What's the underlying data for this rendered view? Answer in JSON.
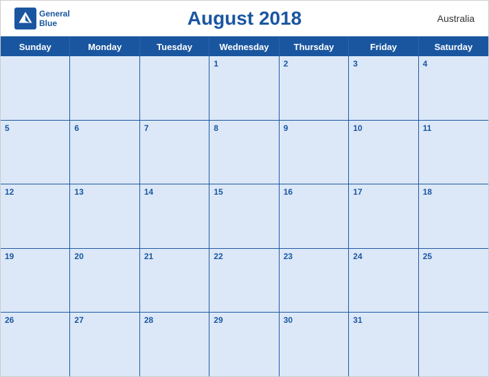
{
  "header": {
    "title": "August 2018",
    "country": "Australia",
    "logo": {
      "line1": "General",
      "line2": "Blue"
    }
  },
  "days_of_week": [
    "Sunday",
    "Monday",
    "Tuesday",
    "Wednesday",
    "Thursday",
    "Friday",
    "Saturday"
  ],
  "weeks": [
    [
      {
        "date": null
      },
      {
        "date": null
      },
      {
        "date": null
      },
      {
        "date": "1"
      },
      {
        "date": "2"
      },
      {
        "date": "3"
      },
      {
        "date": "4"
      }
    ],
    [
      {
        "date": "5"
      },
      {
        "date": "6"
      },
      {
        "date": "7"
      },
      {
        "date": "8"
      },
      {
        "date": "9"
      },
      {
        "date": "10"
      },
      {
        "date": "11"
      }
    ],
    [
      {
        "date": "12"
      },
      {
        "date": "13"
      },
      {
        "date": "14"
      },
      {
        "date": "15"
      },
      {
        "date": "16"
      },
      {
        "date": "17"
      },
      {
        "date": "18"
      }
    ],
    [
      {
        "date": "19"
      },
      {
        "date": "20"
      },
      {
        "date": "21"
      },
      {
        "date": "22"
      },
      {
        "date": "23"
      },
      {
        "date": "24"
      },
      {
        "date": "25"
      }
    ],
    [
      {
        "date": "26"
      },
      {
        "date": "27"
      },
      {
        "date": "28"
      },
      {
        "date": "29"
      },
      {
        "date": "30"
      },
      {
        "date": "31"
      },
      {
        "date": null
      }
    ]
  ]
}
